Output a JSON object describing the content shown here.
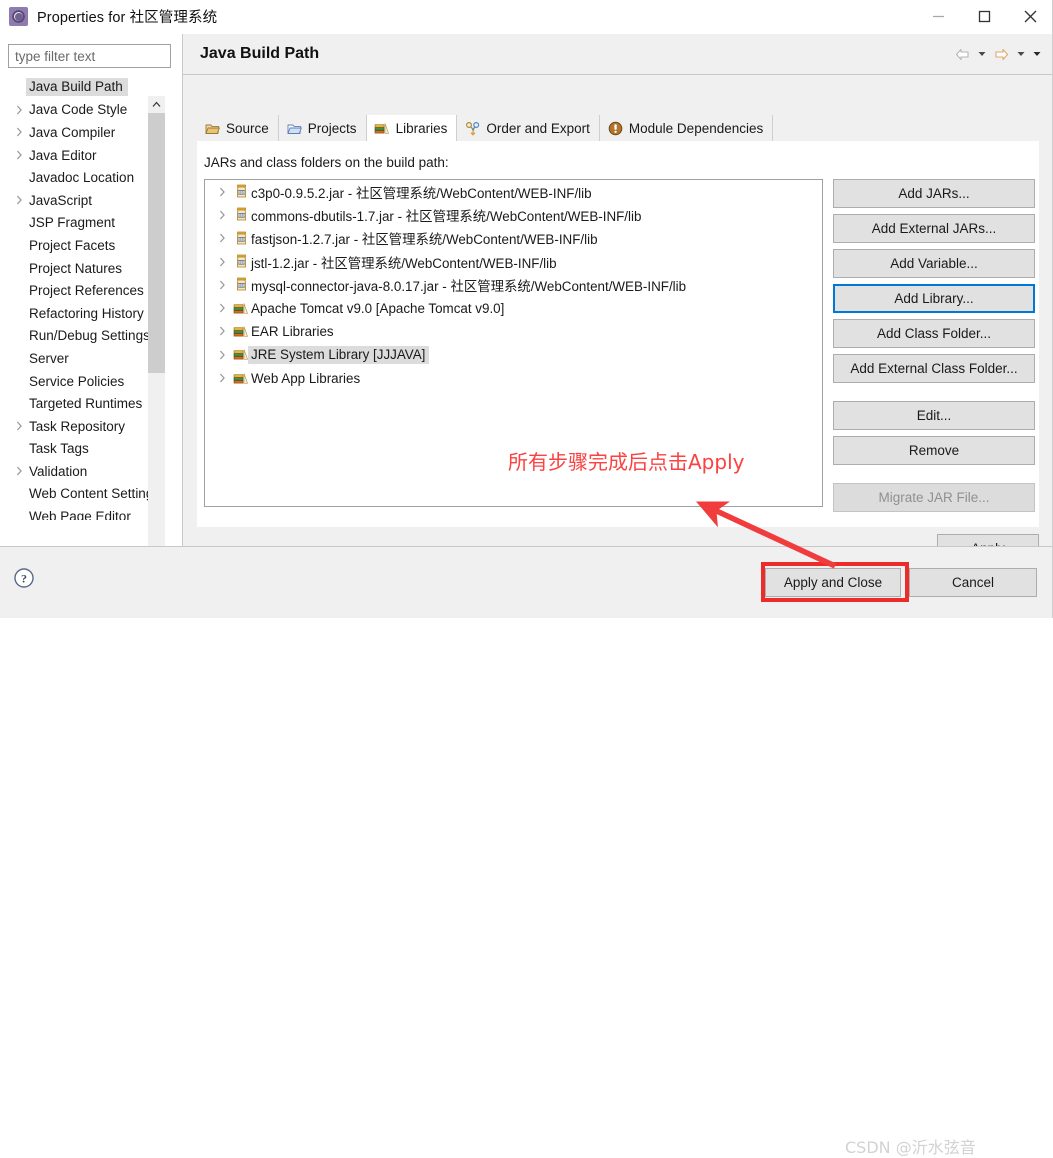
{
  "window": {
    "title": "Properties for 社区管理系统",
    "app_icon": "properties-gear-icon",
    "minimize_label": "Minimize",
    "maximize_label": "Maximize",
    "close_label": "Close"
  },
  "sidebar": {
    "filter": {
      "placeholder": "type filter text",
      "value": ""
    },
    "items": [
      {
        "label": "Java Build Path",
        "expandable": false,
        "selected": true
      },
      {
        "label": "Java Code Style",
        "expandable": true,
        "selected": false
      },
      {
        "label": "Java Compiler",
        "expandable": true,
        "selected": false
      },
      {
        "label": "Java Editor",
        "expandable": true,
        "selected": false
      },
      {
        "label": "Javadoc Location",
        "expandable": false,
        "selected": false
      },
      {
        "label": "JavaScript",
        "expandable": true,
        "selected": false
      },
      {
        "label": "JSP Fragment",
        "expandable": false,
        "selected": false
      },
      {
        "label": "Project Facets",
        "expandable": false,
        "selected": false
      },
      {
        "label": "Project Natures",
        "expandable": false,
        "selected": false
      },
      {
        "label": "Project References",
        "expandable": false,
        "selected": false
      },
      {
        "label": "Refactoring History",
        "expandable": false,
        "selected": false
      },
      {
        "label": "Run/Debug Settings",
        "expandable": false,
        "selected": false
      },
      {
        "label": "Server",
        "expandable": false,
        "selected": false
      },
      {
        "label": "Service Policies",
        "expandable": false,
        "selected": false
      },
      {
        "label": "Targeted Runtimes",
        "expandable": false,
        "selected": false
      },
      {
        "label": "Task Repository",
        "expandable": true,
        "selected": false
      },
      {
        "label": "Task Tags",
        "expandable": false,
        "selected": false
      },
      {
        "label": "Validation",
        "expandable": true,
        "selected": false
      },
      {
        "label": "Web Content Settings",
        "expandable": false,
        "selected": false
      },
      {
        "label": "Web Page Editor",
        "expandable": false,
        "selected": false
      }
    ]
  },
  "page": {
    "title": "Java Build Path",
    "nav_back": "back-arrow-icon",
    "nav_forward": "forward-arrow-icon",
    "menu_caret": "chevron-down-icon"
  },
  "tabs": [
    {
      "label": "Source",
      "icon": "source-folder-icon",
      "active": false
    },
    {
      "label": "Projects",
      "icon": "projects-folder-icon",
      "active": false
    },
    {
      "label": "Libraries",
      "icon": "libraries-books-icon",
      "active": true
    },
    {
      "label": "Order and Export",
      "icon": "order-export-icon",
      "active": false
    },
    {
      "label": "Module Dependencies",
      "icon": "module-dependencies-icon",
      "active": false
    }
  ],
  "libraries_tab": {
    "caption": "JARs and class folders on the build path:",
    "entries": [
      {
        "label": "c3p0-0.9.5.2.jar - 社区管理系统/WebContent/WEB-INF/lib",
        "icon": "jar-icon",
        "selected": false
      },
      {
        "label": "commons-dbutils-1.7.jar - 社区管理系统/WebContent/WEB-INF/lib",
        "icon": "jar-icon",
        "selected": false
      },
      {
        "label": "fastjson-1.2.7.jar - 社区管理系统/WebContent/WEB-INF/lib",
        "icon": "jar-icon",
        "selected": false
      },
      {
        "label": "jstl-1.2.jar - 社区管理系统/WebContent/WEB-INF/lib",
        "icon": "jar-icon",
        "selected": false
      },
      {
        "label": "mysql-connector-java-8.0.17.jar - 社区管理系统/WebContent/WEB-INF/lib",
        "icon": "jar-icon",
        "selected": false
      },
      {
        "label": "Apache Tomcat v9.0 [Apache Tomcat v9.0]",
        "icon": "library-icon",
        "selected": false
      },
      {
        "label": "EAR Libraries",
        "icon": "library-icon",
        "selected": false
      },
      {
        "label": "JRE System Library [JJJAVA]",
        "icon": "library-icon",
        "selected": true
      },
      {
        "label": "Web App Libraries",
        "icon": "library-icon",
        "selected": false
      }
    ],
    "side_buttons": [
      {
        "label": "Add JARs...",
        "state": "normal"
      },
      {
        "label": "Add External JARs...",
        "state": "normal"
      },
      {
        "label": "Add Variable...",
        "state": "normal"
      },
      {
        "label": "Add Library...",
        "state": "focused"
      },
      {
        "label": "Add Class Folder...",
        "state": "normal"
      },
      {
        "label": "Add External Class Folder...",
        "state": "normal"
      },
      {
        "label": "Edit...",
        "state": "normal"
      },
      {
        "label": "Remove",
        "state": "normal"
      },
      {
        "label": "Migrate JAR File...",
        "state": "disabled"
      }
    ]
  },
  "annotation": {
    "text": "所有步骤完成后点击Apply",
    "color": "#fb4141",
    "highlight_color": "#ee2b2b",
    "arrow_color": "#f03c3c"
  },
  "footer": {
    "help_icon": "help-question-icon",
    "apply_label": "Apply",
    "apply_and_close_label": "Apply and Close",
    "cancel_label": "Cancel",
    "watermark": "CSDN @沂水弦音"
  }
}
